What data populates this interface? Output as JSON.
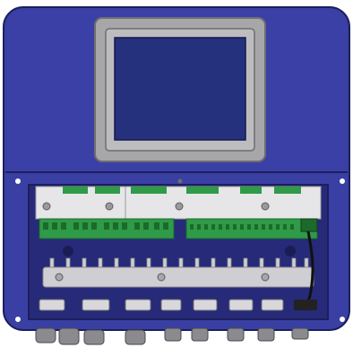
{
  "figure": {
    "subject": "enclosure-with-open-terminal-compartment",
    "colors": {
      "background": "#ffffff",
      "housing": "#3a3fa3",
      "housing_dark": "#262a78",
      "housing_edge": "#1c1f5c",
      "bezel": "#a7a7aa",
      "bezel_dark": "#6e6e72",
      "screen": "#26317e",
      "backplate": "#e6e6e8",
      "terminal_green": "#2f9a47",
      "terminal_dark": "#1b6a2c",
      "busbar": "#cfcfd3",
      "gland": "#8a8a8f"
    },
    "counts": {
      "top_terminal_blocks": 6,
      "busbar_pins": 17,
      "bottom_connectors": 7,
      "cable_glands": 9
    }
  }
}
